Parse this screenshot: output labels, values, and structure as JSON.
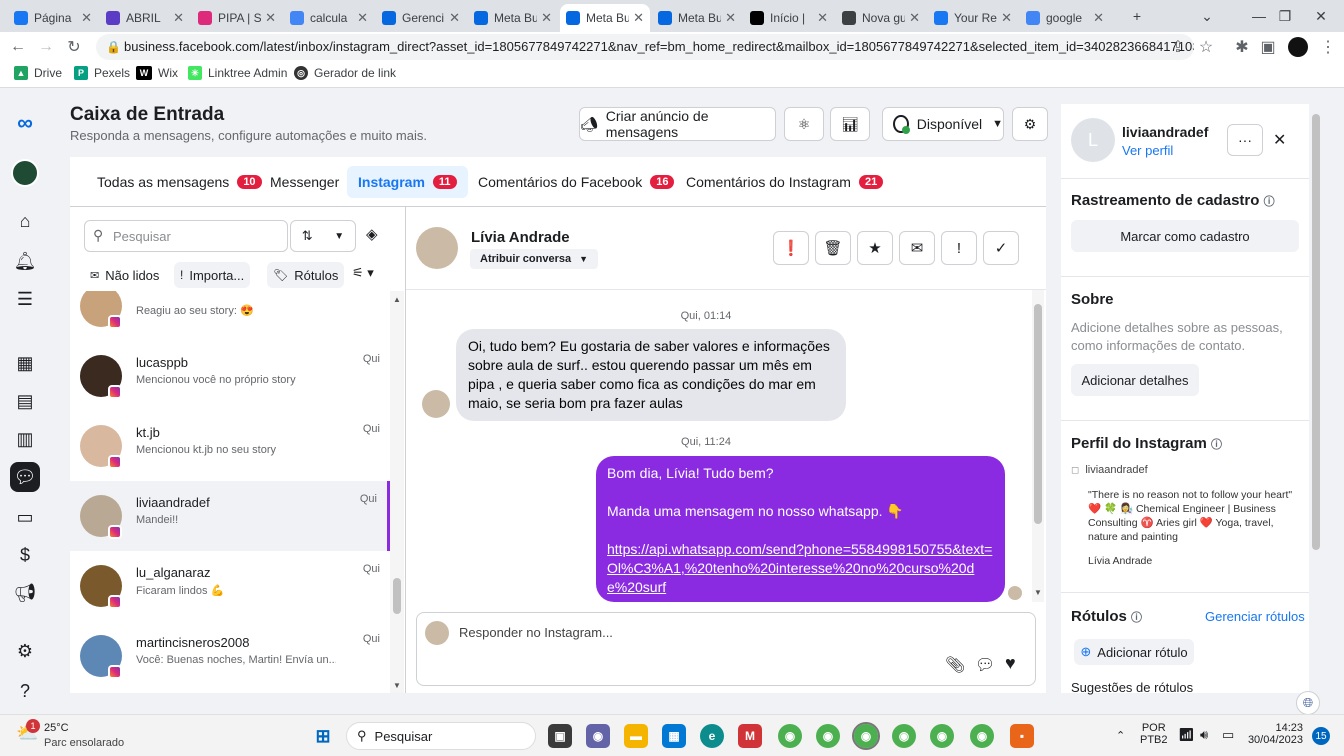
{
  "browser": {
    "tabs": [
      {
        "label": "Página",
        "icon": "facebook-icon",
        "color": "#1877f2"
      },
      {
        "label": "ABRIL",
        "icon": "shield-icon",
        "color": "#5b3cc4"
      },
      {
        "label": "PIPA | S",
        "icon": "instagram-icon",
        "color": "#dd2a7b"
      },
      {
        "label": "calcula",
        "icon": "google-icon",
        "color": "#4285f4"
      },
      {
        "label": "Gerenci",
        "icon": "meta-icon",
        "color": "#0668e1"
      },
      {
        "label": "Meta Bu",
        "icon": "meta-icon",
        "color": "#0668e1"
      },
      {
        "label": "Meta Bu",
        "icon": "meta-icon",
        "color": "#0668e1"
      },
      {
        "label": "Meta Bu",
        "icon": "meta-icon",
        "color": "#0668e1"
      },
      {
        "label": "Início |",
        "icon": "wix-icon",
        "color": "#000000"
      },
      {
        "label": "Nova gu",
        "icon": "globe-icon",
        "color": "#3c4043"
      },
      {
        "label": "Your Re",
        "icon": "facebook-icon",
        "color": "#1877f2"
      },
      {
        "label": "google",
        "icon": "google-icon",
        "color": "#4285f4"
      }
    ],
    "url": "business.facebook.com/latest/inbox/instagram_direct?asset_id=1805677849742271&nav_ref=bm_home_redirect&mailbox_id=1805677849742271&selected_item_id=340282366841710301240...",
    "bookmarks": [
      "Drive",
      "Pexels",
      "Wix",
      "Linktree Admin",
      "Gerador de link"
    ]
  },
  "header": {
    "title": "Caixa de Entrada",
    "subtitle": "Responda a mensagens, configure automações e muito mais.",
    "create_ad_label": "Criar anúncio de mensagens",
    "availability_label": "Disponível"
  },
  "tabs": [
    {
      "label": "Todas as mensagens",
      "badge": "10"
    },
    {
      "label": "Messenger",
      "badge": ""
    },
    {
      "label": "Instagram",
      "badge": "11"
    },
    {
      "label": "Comentários do Facebook",
      "badge": "16"
    },
    {
      "label": "Comentários do Instagram",
      "badge": "21"
    }
  ],
  "list": {
    "search_placeholder": "Pesquisar",
    "filters": [
      "Não lidos",
      "Importa...",
      "Rótulos"
    ],
    "conversations": [
      {
        "name": "",
        "preview": "Reagiu ao seu story: 😍",
        "time": "",
        "color": "#c8a27a"
      },
      {
        "name": "lucasppb",
        "preview": "Mencionou você no próprio story",
        "time": "Qui",
        "color": "#3a2a20"
      },
      {
        "name": "kt.jb",
        "preview": "Mencionou kt.jb no seu story",
        "time": "Qui",
        "color": "#d8b9a0"
      },
      {
        "name": "liviaandradef",
        "preview": "Mandei!!",
        "time": "Qui",
        "color": "#b9a893"
      },
      {
        "name": "lu_alganaraz",
        "preview": "Ficaram lindos 💪",
        "time": "Qui",
        "color": "#7a5a2c"
      },
      {
        "name": "martincisneros2008",
        "preview": "Você: Buenas noches, Martin! Envía un...",
        "time": "Qui",
        "color": "#5d88b5"
      }
    ]
  },
  "chat": {
    "contact_name": "Lívia Andrade",
    "assign_label": "Atribuir conversa",
    "ts1": "Qui, 01:14",
    "incoming": "Oi, tudo bem? Eu gostaria de saber valores e informações sobre aula de surf.. estou querendo passar um mês em pipa , e queria saber como fica as condições do mar em maio, se seria bom pra fazer aulas",
    "ts2": "Qui, 11:24",
    "out_line1": "Bom dia, Lívia! Tudo bem?",
    "out_line2": "Manda uma mensagem no nosso whatsapp. 👇",
    "out_link": "https://api.whatsapp.com/send?phone=5584998150755&text=Ol%C3%A1,%20tenho%20interesse%20no%20curso%20de%20surf",
    "reply_placeholder": "Responder no Instagram..."
  },
  "right": {
    "username": "liviaandradef",
    "view_profile": "Ver perfil",
    "avatar_letter": "L",
    "tracking_title": "Rastreamento de cadastro",
    "mark_button": "Marcar como cadastro",
    "about_title": "Sobre",
    "about_text": "Adicione detalhes sobre as pessoas, como informações de contato.",
    "add_details": "Adicionar detalhes",
    "ig_title": "Perfil do Instagram",
    "ig_user": "liviaandradef",
    "ig_bio": "\"There is no reason not to follow your heart\" ❤️ 🍀 👩‍🔬 Chemical Engineer | Business Consulting ♈ Aries girl ❤️ Yoga, travel, nature and painting",
    "ig_name": "Lívia Andrade",
    "labels_title": "Rótulos",
    "manage_labels": "Gerenciar rótulos",
    "add_label": "Adicionar rótulo",
    "suggestions": "Sugestões de rótulos"
  },
  "taskbar": {
    "temp": "25°C",
    "weather": "Parc ensolarado",
    "weather_badge": "1",
    "search": "Pesquisar",
    "lang1": "POR",
    "lang2": "PTB2",
    "time": "14:23",
    "date": "30/04/2023",
    "notif": "15"
  }
}
